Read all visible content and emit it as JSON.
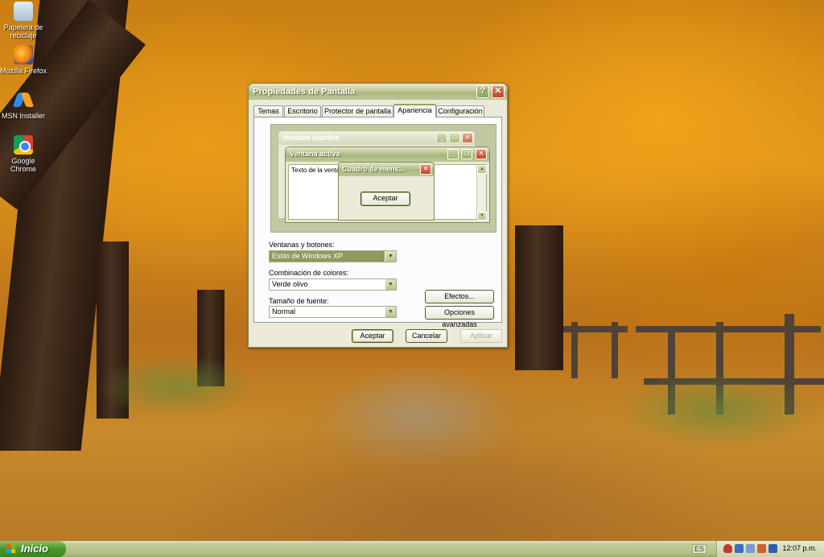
{
  "desktop": {
    "icons": [
      {
        "label": "Papelera de reciclaje",
        "icon": "recycle-bin-icon"
      },
      {
        "label": "Mozilla Firefox",
        "icon": "firefox-icon"
      },
      {
        "label": "MSN Installer",
        "icon": "msn-butterfly-icon"
      },
      {
        "label": "Google Chrome",
        "icon": "chrome-icon"
      }
    ]
  },
  "dialog": {
    "title": "Propiedades de Pantalla",
    "help_btn": "?",
    "close_btn": "✕",
    "tabs": [
      {
        "label": "Temas",
        "active": false
      },
      {
        "label": "Escritorio",
        "active": false
      },
      {
        "label": "Protector de pantalla",
        "active": false
      },
      {
        "label": "Apariencia",
        "active": true
      },
      {
        "label": "Configuración",
        "active": false
      }
    ],
    "preview": {
      "inactive_title": "Ventana inactiva",
      "active_title": "Ventana activa",
      "window_text": "Texto de la ventana",
      "msgbox_title": "Cuadro de mens...",
      "msgbox_button": "Aceptar"
    },
    "windows_buttons_label": "Ventanas y botones:",
    "windows_buttons_value": "Estilo de Windows XP",
    "color_scheme_label": "Combinación de colores:",
    "color_scheme_value": "Verde olivo",
    "font_size_label": "Tamaño de fuente:",
    "font_size_value": "Normal",
    "effects_btn": "Efectos...",
    "advanced_btn": "Opciones avanzadas",
    "ok_btn": "Aceptar",
    "cancel_btn": "Cancelar",
    "apply_btn": "Aplicar",
    "apply_enabled": false
  },
  "taskbar": {
    "start_label": "Inicio",
    "language": "ES",
    "clock": "12:07 p.m."
  },
  "colors": {
    "theme_olive": "#a8b67e",
    "start_green": "#4c9a2a",
    "close_red": "#c4421e"
  }
}
